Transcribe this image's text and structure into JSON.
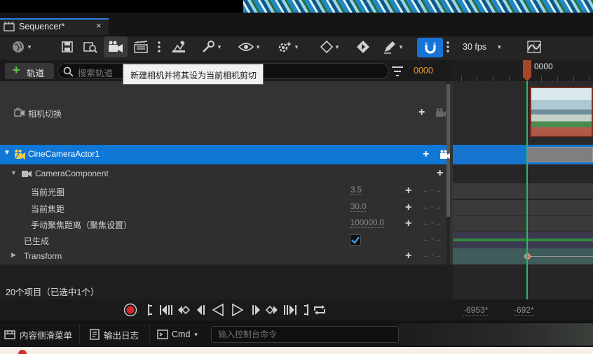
{
  "window": {
    "tab_title": "Sequencer*",
    "close_glyph": "×"
  },
  "toolbar": {
    "fps_label": "30 fps",
    "icons": [
      "world-icon",
      "save-icon",
      "find-asset-icon",
      "create-camera-icon",
      "render-movie-icon",
      "more-icon",
      "actions-icon",
      "wrench-icon",
      "eye-icon",
      "settings-sparkle-icon",
      "key-diamond-icon",
      "key-play-icon",
      "pen-icon",
      "magnet-snap-icon",
      "more-icon",
      "curve-editor-icon"
    ],
    "accent": "#1673d8"
  },
  "search": {
    "add_track_label": "轨道",
    "placeholder": "搜索轨道",
    "current_time": "0000"
  },
  "tooltip": {
    "text": "新建相机并将其设为当前相机剪切"
  },
  "tracks": {
    "camera_cuts": "相机切换",
    "actor": "CineCameraActor1",
    "component": "CameraComponent",
    "aperture_label": "当前光圈",
    "aperture_value": "3.5",
    "focal_label": "当前焦距",
    "focal_value": "30.0",
    "focus_distance_label": "手动聚焦距离（聚焦设置）",
    "focus_distance_value": "100000.0",
    "spawned_label": "已生成",
    "spawned_checked": true,
    "transform_label": "Transform",
    "key_nav": "←◦→"
  },
  "status": {
    "item_count": "20个项目（已选中1个）"
  },
  "timeline": {
    "ruler_label": "0000",
    "range_start": "-6953*",
    "range_end": "-692*",
    "playhead_color": "#2fb36b",
    "selection_color": "#0f77d6"
  },
  "statusbar": {
    "content_drawer": "内容侧滑菜单",
    "output_log": "输出日志",
    "cmd": "Cmd",
    "console_placeholder": "输入控制台命令"
  }
}
